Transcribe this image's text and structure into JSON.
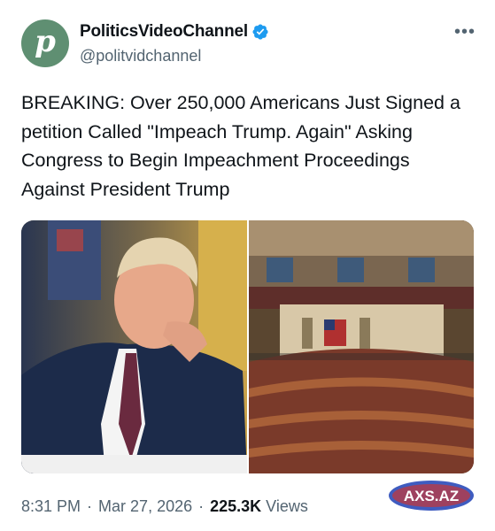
{
  "account": {
    "display_name": "PoliticsVideoChannel",
    "handle": "@politvidchannel",
    "avatar_letter": "p",
    "verified": true
  },
  "tweet": {
    "text": "BREAKING: Over 250,000 Americans Just Signed a petition Called \"Impeach Trump. Again\" Asking Congress to Begin Impeachment Proceedings Against President Trump"
  },
  "media": {
    "images": [
      "photo-trump-portrait",
      "photo-house-chamber"
    ]
  },
  "footer": {
    "time": "8:31 PM",
    "date": "Mar 27, 2026",
    "views_count": "225.3K",
    "views_label": "Views"
  },
  "watermark": {
    "text": "AXS.AZ"
  },
  "colors": {
    "avatar_bg": "#5f8f72",
    "verified_blue": "#1d9bf0",
    "secondary_text": "#536471",
    "primary_text": "#0f1419"
  }
}
